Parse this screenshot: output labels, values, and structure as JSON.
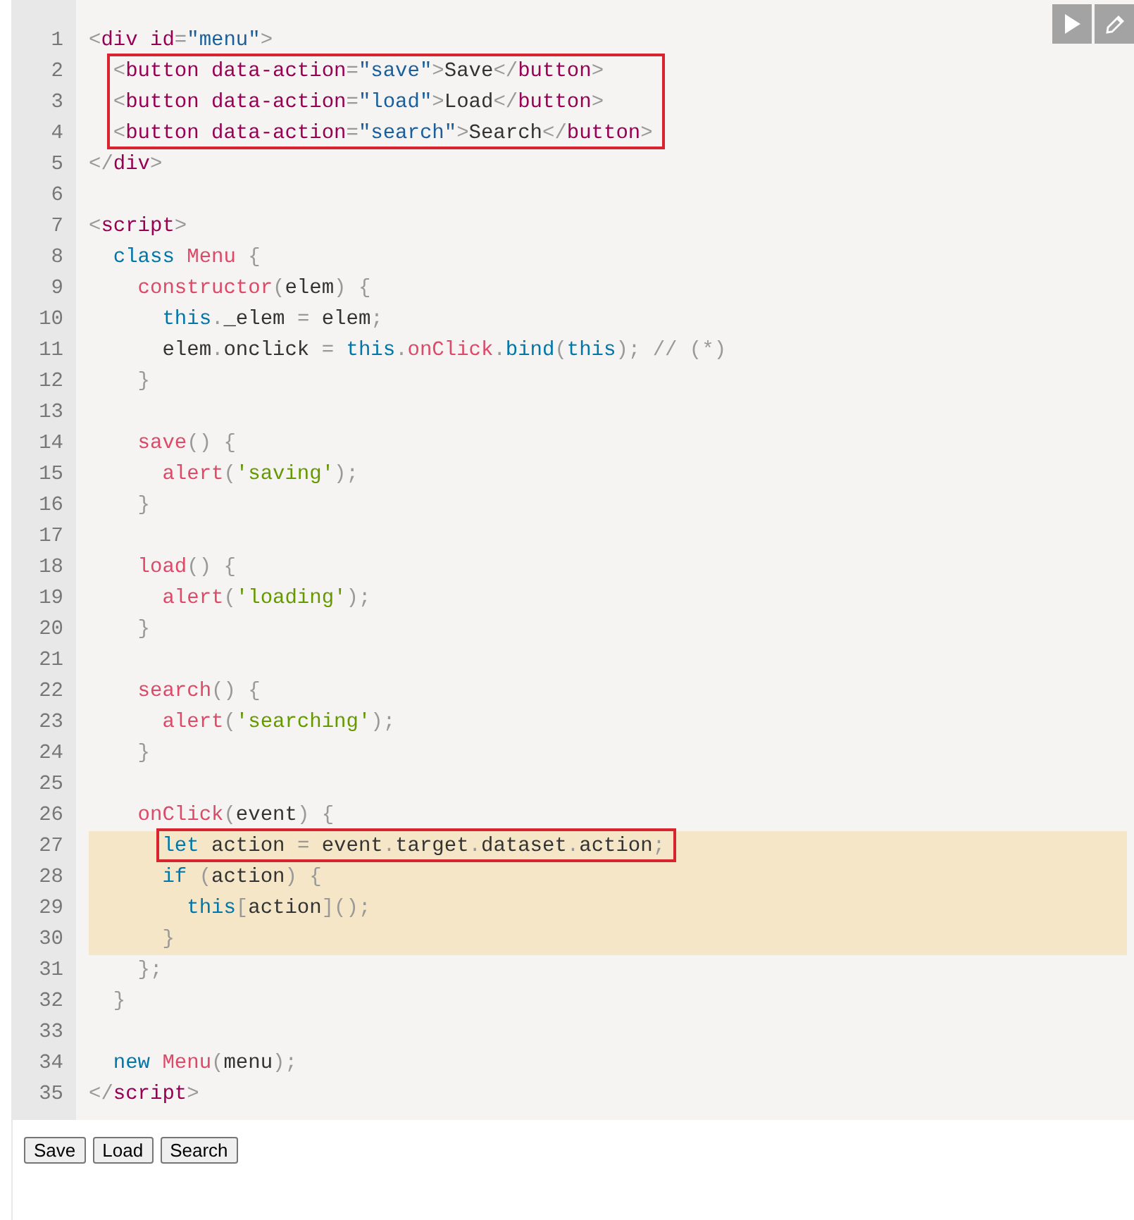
{
  "toolbar": {
    "buttons": [
      {
        "kind": "run"
      },
      {
        "kind": "edit"
      }
    ]
  },
  "code": {
    "lines": [
      {
        "number": "1",
        "tokens": [
          {
            "kind": "p",
            "text": "<"
          },
          {
            "kind": "tag",
            "text": "div "
          },
          {
            "kind": "attr",
            "text": "id"
          },
          {
            "kind": "p",
            "text": "="
          },
          {
            "kind": "val",
            "text": "\"menu\""
          },
          {
            "kind": "p",
            "text": ">"
          }
        ],
        "boxed": false,
        "highlighted": false
      },
      {
        "number": "2",
        "tokens": [
          {
            "kind": "p",
            "text": "  <"
          },
          {
            "kind": "tag",
            "text": "button "
          },
          {
            "kind": "attr",
            "text": "data-action"
          },
          {
            "kind": "p",
            "text": "="
          },
          {
            "kind": "val",
            "text": "\"save\""
          },
          {
            "kind": "p",
            "text": ">"
          },
          {
            "kind": "t",
            "text": "Save"
          },
          {
            "kind": "p",
            "text": "</"
          },
          {
            "kind": "tag",
            "text": "button"
          },
          {
            "kind": "p",
            "text": ">"
          }
        ],
        "boxed": true,
        "highlighted": false
      },
      {
        "number": "3",
        "tokens": [
          {
            "kind": "p",
            "text": "  <"
          },
          {
            "kind": "tag",
            "text": "button "
          },
          {
            "kind": "attr",
            "text": "data-action"
          },
          {
            "kind": "p",
            "text": "="
          },
          {
            "kind": "val",
            "text": "\"load\""
          },
          {
            "kind": "p",
            "text": ">"
          },
          {
            "kind": "t",
            "text": "Load"
          },
          {
            "kind": "p",
            "text": "</"
          },
          {
            "kind": "tag",
            "text": "button"
          },
          {
            "kind": "p",
            "text": ">"
          }
        ],
        "boxed": true,
        "highlighted": false
      },
      {
        "number": "4",
        "tokens": [
          {
            "kind": "p",
            "text": "  <"
          },
          {
            "kind": "tag",
            "text": "button "
          },
          {
            "kind": "attr",
            "text": "data-action"
          },
          {
            "kind": "p",
            "text": "="
          },
          {
            "kind": "val",
            "text": "\"search\""
          },
          {
            "kind": "p",
            "text": ">"
          },
          {
            "kind": "t",
            "text": "Search"
          },
          {
            "kind": "p",
            "text": "</"
          },
          {
            "kind": "tag",
            "text": "button"
          },
          {
            "kind": "p",
            "text": ">"
          }
        ],
        "boxed": true,
        "highlighted": false
      },
      {
        "number": "5",
        "tokens": [
          {
            "kind": "p",
            "text": "</"
          },
          {
            "kind": "tag",
            "text": "div"
          },
          {
            "kind": "p",
            "text": ">"
          }
        ],
        "boxed": false,
        "highlighted": false
      },
      {
        "number": "6",
        "boxed": false,
        "highlighted": false
      },
      {
        "number": "7",
        "tokens": [
          {
            "kind": "p",
            "text": "<"
          },
          {
            "kind": "tag",
            "text": "script"
          },
          {
            "kind": "p",
            "text": ">"
          }
        ],
        "boxed": false,
        "highlighted": false
      },
      {
        "number": "8",
        "tokens": [
          {
            "kind": "kw",
            "text": "  class "
          },
          {
            "kind": "fn",
            "text": "Menu "
          },
          {
            "kind": "p",
            "text": "{"
          }
        ],
        "boxed": false,
        "highlighted": false
      },
      {
        "number": "9",
        "tokens": [
          {
            "kind": "fn",
            "text": "    constructor"
          },
          {
            "kind": "p",
            "text": "("
          },
          {
            "kind": "t",
            "text": "elem"
          },
          {
            "kind": "p",
            "text": ") {"
          }
        ],
        "boxed": false,
        "highlighted": false
      },
      {
        "number": "10",
        "tokens": [
          {
            "kind": "kw",
            "text": "      this"
          },
          {
            "kind": "p",
            "text": "."
          },
          {
            "kind": "t",
            "text": "_elem "
          },
          {
            "kind": "p",
            "text": "="
          },
          {
            "kind": "t",
            "text": " elem"
          },
          {
            "kind": "p",
            "text": ";"
          }
        ],
        "boxed": false,
        "highlighted": false
      },
      {
        "number": "11",
        "tokens": [
          {
            "kind": "t",
            "text": "      elem"
          },
          {
            "kind": "p",
            "text": "."
          },
          {
            "kind": "t",
            "text": "onclick "
          },
          {
            "kind": "p",
            "text": "= "
          },
          {
            "kind": "kw",
            "text": "this"
          },
          {
            "kind": "p",
            "text": "."
          },
          {
            "kind": "fn",
            "text": "onClick"
          },
          {
            "kind": "p",
            "text": "."
          },
          {
            "kind": "kw",
            "text": "bind"
          },
          {
            "kind": "p",
            "text": "("
          },
          {
            "kind": "kw",
            "text": "this"
          },
          {
            "kind": "p",
            "text": "); "
          },
          {
            "kind": "cm",
            "text": "// (*)"
          }
        ],
        "boxed": false,
        "highlighted": false
      },
      {
        "number": "12",
        "tokens": [
          {
            "kind": "p",
            "text": "    }"
          }
        ],
        "boxed": false,
        "highlighted": false
      },
      {
        "number": "13",
        "boxed": false,
        "highlighted": false
      },
      {
        "number": "14",
        "tokens": [
          {
            "kind": "fn",
            "text": "    save"
          },
          {
            "kind": "p",
            "text": "() {"
          }
        ],
        "boxed": false,
        "highlighted": false
      },
      {
        "number": "15",
        "tokens": [
          {
            "kind": "fn",
            "text": "      alert"
          },
          {
            "kind": "p",
            "text": "("
          },
          {
            "kind": "str",
            "text": "'saving'"
          },
          {
            "kind": "p",
            "text": ");"
          }
        ],
        "boxed": false,
        "highlighted": false
      },
      {
        "number": "16",
        "tokens": [
          {
            "kind": "p",
            "text": "    }"
          }
        ],
        "boxed": false,
        "highlighted": false
      },
      {
        "number": "17",
        "boxed": false,
        "highlighted": false
      },
      {
        "number": "18",
        "tokens": [
          {
            "kind": "fn",
            "text": "    load"
          },
          {
            "kind": "p",
            "text": "() {"
          }
        ],
        "boxed": false,
        "highlighted": false
      },
      {
        "number": "19",
        "tokens": [
          {
            "kind": "fn",
            "text": "      alert"
          },
          {
            "kind": "p",
            "text": "("
          },
          {
            "kind": "str",
            "text": "'loading'"
          },
          {
            "kind": "p",
            "text": ");"
          }
        ],
        "boxed": false,
        "highlighted": false
      },
      {
        "number": "20",
        "tokens": [
          {
            "kind": "p",
            "text": "    }"
          }
        ],
        "boxed": false,
        "highlighted": false
      },
      {
        "number": "21",
        "boxed": false,
        "highlighted": false
      },
      {
        "number": "22",
        "tokens": [
          {
            "kind": "fn",
            "text": "    search"
          },
          {
            "kind": "p",
            "text": "() {"
          }
        ],
        "boxed": false,
        "highlighted": false
      },
      {
        "number": "23",
        "tokens": [
          {
            "kind": "fn",
            "text": "      alert"
          },
          {
            "kind": "p",
            "text": "("
          },
          {
            "kind": "str",
            "text": "'searching'"
          },
          {
            "kind": "p",
            "text": ");"
          }
        ],
        "boxed": false,
        "highlighted": false
      },
      {
        "number": "24",
        "tokens": [
          {
            "kind": "p",
            "text": "    }"
          }
        ],
        "boxed": false,
        "highlighted": false
      },
      {
        "number": "25",
        "boxed": false,
        "highlighted": false
      },
      {
        "number": "26",
        "tokens": [
          {
            "kind": "fn",
            "text": "    onClick"
          },
          {
            "kind": "p",
            "text": "("
          },
          {
            "kind": "t",
            "text": "event"
          },
          {
            "kind": "p",
            "text": ") {"
          }
        ],
        "boxed": false,
        "highlighted": false
      },
      {
        "number": "27",
        "tokens": [
          {
            "kind": "kw",
            "text": "      let"
          },
          {
            "kind": "t",
            "text": " action "
          },
          {
            "kind": "p",
            "text": "="
          },
          {
            "kind": "t",
            "text": " event"
          },
          {
            "kind": "p",
            "text": "."
          },
          {
            "kind": "t",
            "text": "target"
          },
          {
            "kind": "p",
            "text": "."
          },
          {
            "kind": "t",
            "text": "dataset"
          },
          {
            "kind": "p",
            "text": "."
          },
          {
            "kind": "t",
            "text": "action"
          },
          {
            "kind": "p",
            "text": ";"
          }
        ],
        "boxed": true,
        "highlighted": true
      },
      {
        "number": "28",
        "tokens": [
          {
            "kind": "kw",
            "text": "      if "
          },
          {
            "kind": "p",
            "text": "("
          },
          {
            "kind": "t",
            "text": "action"
          },
          {
            "kind": "p",
            "text": ") {"
          }
        ],
        "boxed": false,
        "highlighted": true
      },
      {
        "number": "29",
        "tokens": [
          {
            "kind": "kw",
            "text": "        this"
          },
          {
            "kind": "p",
            "text": "["
          },
          {
            "kind": "t",
            "text": "action"
          },
          {
            "kind": "p",
            "text": "]();"
          }
        ],
        "boxed": false,
        "highlighted": true
      },
      {
        "number": "30",
        "tokens": [
          {
            "kind": "p",
            "text": "      }"
          }
        ],
        "boxed": false,
        "highlighted": true
      },
      {
        "number": "31",
        "tokens": [
          {
            "kind": "p",
            "text": "    };"
          }
        ],
        "boxed": false,
        "highlighted": false
      },
      {
        "number": "32",
        "tokens": [
          {
            "kind": "p",
            "text": "  }"
          }
        ],
        "boxed": false,
        "highlighted": false
      },
      {
        "number": "33",
        "boxed": false,
        "highlighted": false
      },
      {
        "number": "34",
        "tokens": [
          {
            "kind": "kw",
            "text": "  new "
          },
          {
            "kind": "fn",
            "text": "Menu"
          },
          {
            "kind": "p",
            "text": "("
          },
          {
            "kind": "t",
            "text": "menu"
          },
          {
            "kind": "p",
            "text": ");"
          }
        ],
        "boxed": false,
        "highlighted": false
      },
      {
        "number": "35",
        "tokens": [
          {
            "kind": "p",
            "text": "</"
          },
          {
            "kind": "tag",
            "text": "script"
          },
          {
            "kind": "p",
            "text": ">"
          }
        ],
        "boxed": false,
        "highlighted": false
      }
    ]
  },
  "result": {
    "buttons": [
      "Save",
      "Load",
      "Search"
    ]
  }
}
